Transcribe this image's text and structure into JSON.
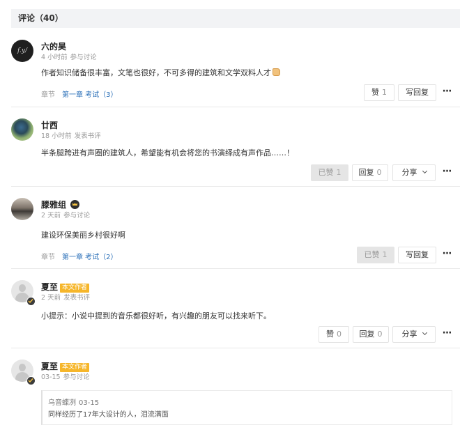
{
  "header": {
    "title": "评论（40）"
  },
  "comments": [
    {
      "name": "六的昊",
      "time": "4 小时前",
      "action": "参与讨论",
      "text": "作者知识储备很丰富，文笔也很好，不可多得的建筑和文学双料人才",
      "chapter_label": "章节",
      "chapter_link": "第一章 考试（3）",
      "like_label": "赞",
      "like_count": "1",
      "reply_label": "写回复",
      "more": "···"
    },
    {
      "name": "廿西",
      "time": "18 小时前",
      "action": "发表书评",
      "text": "半条腿跨进有声圈的建筑人，希望能有机会将您的书演绎成有声作品……！",
      "like_label": "已赞",
      "like_count": "1",
      "reply_label": "回复",
      "reply_count": "0",
      "share_label": "分享",
      "more": "···"
    },
    {
      "name": "滕雅组",
      "time": "2 天前",
      "action": "参与讨论",
      "text": "建设环保美丽乡村很好啊",
      "chapter_label": "章节",
      "chapter_link": "第一章 考试（2）",
      "like_label": "已赞",
      "like_count": "1",
      "reply_label": "写回复",
      "more": "···"
    },
    {
      "name": "夏至",
      "tag": "本文作者",
      "time": "2 天前",
      "action": "发表书评",
      "text": "小提示：小说中提到的音乐都很好听，有兴趣的朋友可以找来听下。",
      "like_label": "赞",
      "like_count": "0",
      "reply_label": "回复",
      "reply_count": "0",
      "share_label": "分享",
      "more": "···"
    },
    {
      "name": "夏至",
      "tag": "本文作者",
      "time": "03-15",
      "action": "参与讨论",
      "quote": {
        "author": "乌音蝶冽",
        "time": "03-15",
        "text": "同样经历了17年大设计的人，泪流满面"
      }
    }
  ]
}
